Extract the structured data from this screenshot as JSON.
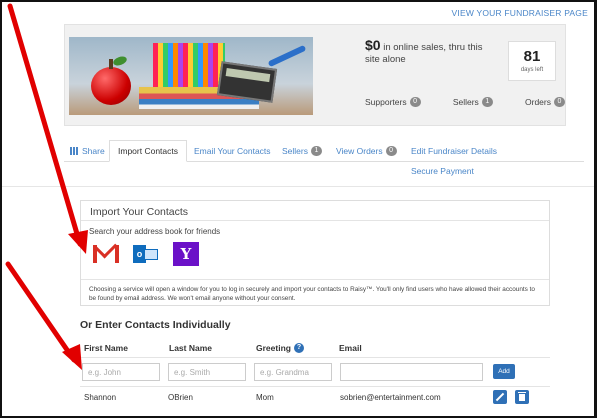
{
  "header": {
    "view_fundraiser_link": "VIEW YOUR FUNDRAISER PAGE"
  },
  "summary": {
    "amount": "$0",
    "sales_text": "in online sales, thru this site alone",
    "days_left_number": "81",
    "days_left_label": "days left",
    "supporters_label": "Supporters",
    "supporters_count": "0",
    "sellers_label": "Sellers",
    "sellers_count": "1",
    "orders_label": "Orders",
    "orders_count": "0"
  },
  "tabs": {
    "share": "Share",
    "import_contacts": "Import Contacts",
    "email_contacts": "Email Your Contacts",
    "sellers": "Sellers",
    "sellers_count": "1",
    "view_orders": "View Orders",
    "view_orders_count": "0",
    "edit_details": "Edit Fundraiser Details",
    "secure_payment": "Secure Payment"
  },
  "import_panel": {
    "title": "Import Your Contacts",
    "subtitle": "Search your address book for friends",
    "services": [
      "gmail",
      "outlook",
      "yahoo"
    ],
    "note": "Choosing a service will open a window for you to log in securely and import your contacts to Raisy™. You'll only find users who have allowed their accounts to be found by email address. We won't email anyone without your consent."
  },
  "manual_entry": {
    "title": "Or Enter Contacts Individually",
    "columns": {
      "first_name": "First Name",
      "last_name": "Last Name",
      "greeting": "Greeting",
      "email": "Email"
    },
    "placeholders": {
      "first_name": "e.g. John",
      "last_name": "e.g. Smith",
      "greeting": "e.g. Grandma",
      "email": ""
    },
    "add_label": "Add",
    "rows": [
      {
        "first_name": "Shannon",
        "last_name": "OBrien",
        "greeting": "Mom",
        "email": "sobrien@entertainment.com"
      }
    ]
  },
  "colors": {
    "link": "#4a86c8",
    "primary_button": "#2f70b6",
    "badge": "#8a8a8a",
    "annotation_arrow": "#e10000"
  }
}
